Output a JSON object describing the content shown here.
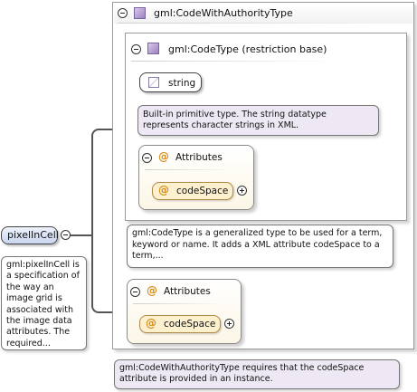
{
  "element": {
    "name": "pixelInCell",
    "documentation": "gml:pixelInCell is a specification of the way an image grid is associated with the image data attributes. The required..."
  },
  "outer_type": {
    "name": "gml:CodeWithAuthorityType",
    "documentation": "gml:CodeWithAuthorityType requires that the codeSpace attribute is provided in an instance."
  },
  "inner_type": {
    "name": "gml:CodeType (restriction base)",
    "documentation": "gml:CodeType is a generalized type to be used for a term, keyword or name. It adds a XML attribute codeSpace to a term,..."
  },
  "string_type": {
    "name": "string",
    "documentation": "Built-in primitive type. The string datatype represents character strings in XML."
  },
  "attributes_inner": {
    "label": "Attributes",
    "at_symbol": "@",
    "item": "codeSpace"
  },
  "attributes_outer": {
    "label": "Attributes",
    "at_symbol": "@",
    "item": "codeSpace"
  },
  "icons": {
    "collapse": "collapse-circle-icon",
    "expand": "expand-circle-icon",
    "type": "complex-type-icon",
    "simple": "simple-type-icon",
    "attribute": "attribute-icon"
  }
}
